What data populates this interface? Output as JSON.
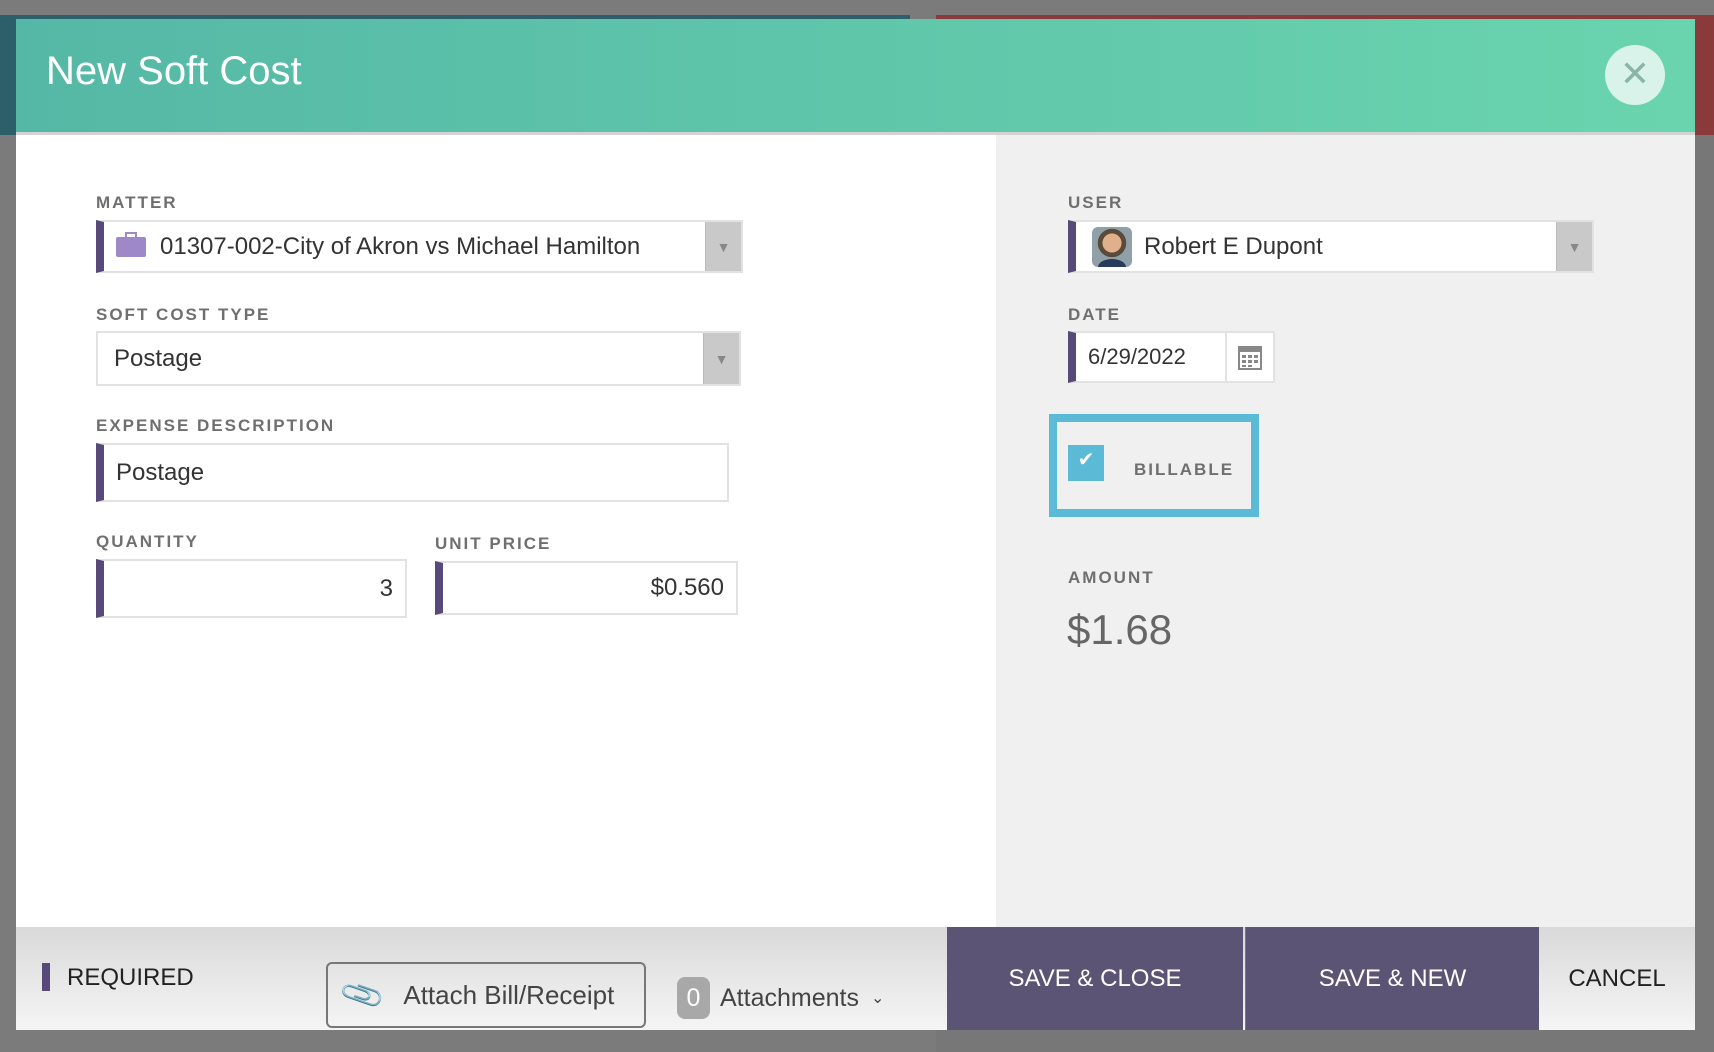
{
  "dialog": {
    "title": "New Soft Cost",
    "close_icon": "close-icon"
  },
  "form": {
    "matter": {
      "label": "MATTER",
      "value": "01307-002-City of Akron vs Michael Hamilton",
      "icon": "briefcase-icon"
    },
    "soft_cost_type": {
      "label": "SOFT COST TYPE",
      "value": "Postage"
    },
    "expense_description": {
      "label": "EXPENSE DESCRIPTION",
      "value": "Postage"
    },
    "quantity": {
      "label": "QUANTITY",
      "value": "3"
    },
    "unit_price": {
      "label": "UNIT PRICE",
      "value": "$0.560"
    },
    "user": {
      "label": "USER",
      "value": "Robert E Dupont"
    },
    "date": {
      "label": "DATE",
      "value": "6/29/2022"
    },
    "billable": {
      "label": "BILLABLE",
      "checked": true
    },
    "amount": {
      "label": "AMOUNT",
      "value": "$1.68"
    }
  },
  "footer": {
    "required": "REQUIRED",
    "attach": "Attach Bill/Receipt",
    "attachments_count": "0",
    "attachments": "Attachments",
    "save_close": "SAVE & CLOSE",
    "save_new": "SAVE & NEW",
    "cancel": "CANCEL"
  },
  "colors": {
    "header_start": "#55b8a6",
    "header_end": "#6ad4ae",
    "required_bar": "#574a7a",
    "save_button": "#5c5474",
    "billable_border": "#5bbad6"
  }
}
